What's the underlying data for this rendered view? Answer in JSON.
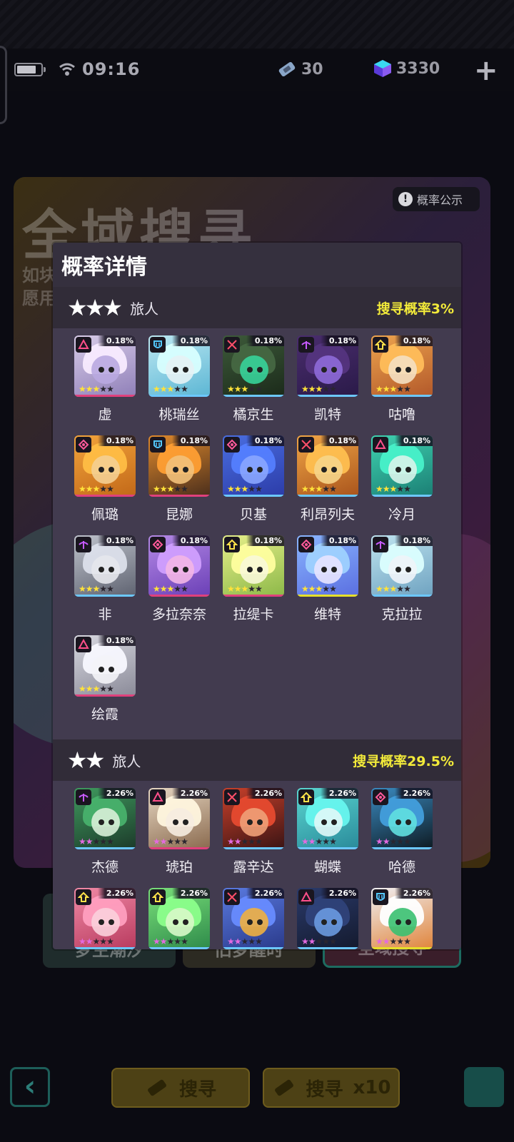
{
  "status_bar": {
    "time": "09:16",
    "tickets": "30",
    "crystals": "3330"
  },
  "banner": {
    "title": "全域搜寻",
    "line1": "如块",
    "line2": "愿用",
    "prob_notice": "概率公示"
  },
  "bottom_tabs": [
    "梦生潮汐",
    "旧梦醒时",
    "全域搜寻"
  ],
  "bottom_buttons": {
    "search_one": "搜寻",
    "search_one_count": "1",
    "search_ten": "搜寻",
    "search_ten_suffix": "x10",
    "search_ten_count": "10"
  },
  "modal": {
    "title": "概率详情",
    "tiers": [
      {
        "stars": "★★★",
        "label": "旅人",
        "rate": "搜寻概率3%",
        "characters": [
          {
            "name": "虚",
            "pct": "0.18%",
            "class": "caster",
            "colors": [
              "#d8cce8",
              "#8f7fb8",
              "#b9a8e0"
            ],
            "bar": "#e0407c"
          },
          {
            "name": "桃瑞丝",
            "pct": "0.18%",
            "class": "tank",
            "colors": [
              "#bde8f2",
              "#5bb6d4",
              "#e6f2f5"
            ],
            "bar": "#6cc8ff"
          },
          {
            "name": "橘京生",
            "pct": "0.18%",
            "class": "sword",
            "colors": [
              "#3d5a3a",
              "#1b2a1a",
              "#37d39a"
            ],
            "bar": "#6cc8ff"
          },
          {
            "name": "凯特",
            "pct": "0.18%",
            "class": "archer",
            "colors": [
              "#4a2d6e",
              "#2a1a48",
              "#8e6ad9"
            ],
            "bar": "#6cc8ff"
          },
          {
            "name": "咕噜",
            "pct": "0.18%",
            "class": "support",
            "colors": [
              "#eda44e",
              "#b2582a",
              "#f4e0c2"
            ],
            "bar": "#6cc8ff"
          },
          {
            "name": "佩璐",
            "pct": "0.18%",
            "class": "healer",
            "colors": [
              "#f2a43c",
              "#c26818",
              "#f4cf92"
            ],
            "bar": "#e0407c"
          },
          {
            "name": "昆娜",
            "pct": "0.18%",
            "class": "tank",
            "colors": [
              "#e08a2c",
              "#4a2e1c",
              "#f2c17a"
            ],
            "bar": "#e0407c"
          },
          {
            "name": "贝基",
            "pct": "0.18%",
            "class": "healer",
            "colors": [
              "#4a6ee0",
              "#2c3ca8",
              "#8aa6ff"
            ],
            "bar": "#6cc8ff"
          },
          {
            "name": "利昂列夫",
            "pct": "0.18%",
            "class": "sword",
            "colors": [
              "#f0a646",
              "#a9541c",
              "#f6d58a"
            ],
            "bar": "#6cc8ff"
          },
          {
            "name": "冷月",
            "pct": "0.18%",
            "class": "caster",
            "colors": [
              "#3fd2b0",
              "#1b7e74",
              "#d8f4ea"
            ],
            "bar": "#6cc8ff"
          },
          {
            "name": "非",
            "pct": "0.18%",
            "class": "archer",
            "colors": [
              "#bfc3cc",
              "#5e6270",
              "#e5e7ec"
            ],
            "bar": "#6cc8ff"
          },
          {
            "name": "多拉奈奈",
            "pct": "0.18%",
            "class": "healer",
            "colors": [
              "#b58ae6",
              "#6a3fb6",
              "#f3b6e6"
            ],
            "bar": "#e0407c"
          },
          {
            "name": "拉缇卡",
            "pct": "0.18%",
            "class": "support",
            "colors": [
              "#e6ef8a",
              "#8cb848",
              "#f8f8d8"
            ],
            "bar": "#e0407c"
          },
          {
            "name": "维特",
            "pct": "0.18%",
            "class": "healer",
            "colors": [
              "#8ab6ff",
              "#5a6ee0",
              "#e8e4ff"
            ],
            "bar": "#e6e02a"
          },
          {
            "name": "克拉拉",
            "pct": "0.18%",
            "class": "archer",
            "colors": [
              "#bfe4f0",
              "#6ea2c0",
              "#f0f4f8"
            ],
            "bar": "#6cc8ff"
          },
          {
            "name": "绘霞",
            "pct": "0.18%",
            "class": "caster",
            "colors": [
              "#d8d8e0",
              "#8a8a98",
              "#f4f4f8"
            ],
            "bar": "#e0407c"
          }
        ]
      },
      {
        "stars": "★★",
        "label": "旅人",
        "rate": "搜寻概率29.5%",
        "characters": [
          {
            "name": "杰德",
            "pct": "2.26%",
            "class": "archer",
            "colors": [
              "#3f9a5e",
              "#1c3a2a",
              "#d8f0d8"
            ],
            "bar": "#6cc8ff"
          },
          {
            "name": "琥珀",
            "pct": "2.26%",
            "class": "caster",
            "colors": [
              "#e6d6c2",
              "#8a6a4e",
              "#f6ece0"
            ],
            "bar": "#e0407c"
          },
          {
            "name": "露辛达",
            "pct": "2.26%",
            "class": "sword",
            "colors": [
              "#c8402a",
              "#3a1414",
              "#f0a078"
            ],
            "bar": "#6cc8ff"
          },
          {
            "name": "蝴蝶",
            "pct": "2.26%",
            "class": "support",
            "colors": [
              "#5ad6d0",
              "#2a8a9a",
              "#e0f8f8"
            ],
            "bar": "#6cc8ff"
          },
          {
            "name": "哈德",
            "pct": "2.26%",
            "class": "healer",
            "colors": [
              "#3a8ac0",
              "#0e1a22",
              "#60e0e0"
            ],
            "bar": "#6cc8ff"
          },
          {
            "name": "",
            "pct": "2.26%",
            "class": "support",
            "colors": [
              "#f08aa6",
              "#b83a5e",
              "#fbd0dc"
            ],
            "bar": "#6cc8ff"
          },
          {
            "name": "",
            "pct": "2.26%",
            "class": "support",
            "colors": [
              "#7ae07a",
              "#2e8a4a",
              "#d8f8c8"
            ],
            "bar": "#6cc8ff"
          },
          {
            "name": "",
            "pct": "2.26%",
            "class": "sword",
            "colors": [
              "#5a7ae0",
              "#2a3a8a",
              "#f0b040"
            ],
            "bar": "#6cc8ff"
          },
          {
            "name": "",
            "pct": "2.26%",
            "class": "caster",
            "colors": [
              "#2a3a6a",
              "#141a2e",
              "#6a9ae0"
            ],
            "bar": "#6cc8ff"
          },
          {
            "name": "",
            "pct": "2.26%",
            "class": "tank",
            "colors": [
              "#f0f0f4",
              "#e0843a",
              "#3ac070"
            ],
            "bar": "#e6e02a"
          }
        ]
      }
    ]
  },
  "colors": {
    "rate_yellow": "#f2ea3a",
    "modal_bg": "#423b4f",
    "tier_header_bg": "#312c38"
  }
}
